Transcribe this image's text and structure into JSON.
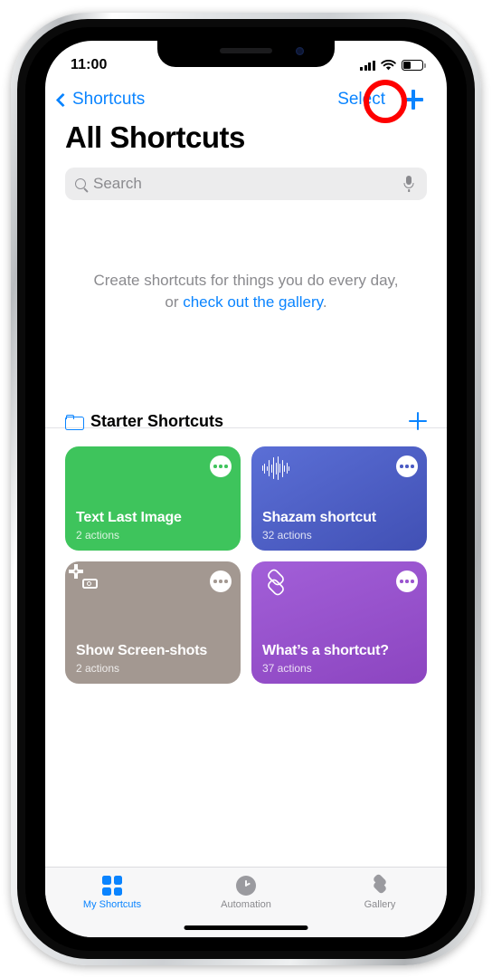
{
  "status_bar": {
    "time": "11:00",
    "signal_icon": "cellular-signal-icon",
    "wifi_icon": "wifi-icon",
    "battery_icon": "battery-icon",
    "battery_level_pct": 38
  },
  "nav": {
    "back_label": "Shortcuts",
    "back_icon": "chevron-left-icon",
    "select_label": "Select",
    "add_icon": "plus-icon"
  },
  "annotation": {
    "shape": "circle",
    "color": "#fe0000",
    "target": "add-shortcut-button"
  },
  "page": {
    "title": "All Shortcuts"
  },
  "search": {
    "placeholder": "Search",
    "icon": "magnifier-icon",
    "mic_icon": "microphone-icon"
  },
  "empty_state": {
    "line1": "Create shortcuts for things you do every day,",
    "prefix": "or ",
    "link": "check out the gallery",
    "suffix": "."
  },
  "section": {
    "title": "Starter Shortcuts",
    "folder_icon": "folder-icon",
    "add_icon": "plus-icon"
  },
  "shortcuts": [
    {
      "name": "Text Last Image",
      "actions": "2 actions",
      "color": "#3ec45c",
      "icon": "message-bubble-plus-icon",
      "menu_icon": "ellipsis-icon"
    },
    {
      "name": "Shazam shortcut",
      "actions": "32 actions",
      "color": "#4a5bc4",
      "icon": "waveform-icon",
      "menu_icon": "ellipsis-icon"
    },
    {
      "name": "Show Screen-shots",
      "actions": "2 actions",
      "color": "#a39891",
      "icon": "screenshot-scan-icon",
      "menu_icon": "ellipsis-icon"
    },
    {
      "name": "What’s a shortcut?",
      "actions": "37 actions",
      "color": "#9a54cf",
      "icon": "layers-icon",
      "menu_icon": "ellipsis-icon"
    }
  ],
  "tabs": [
    {
      "label": "My Shortcuts",
      "icon": "grid-squares-icon",
      "active": true
    },
    {
      "label": "Automation",
      "icon": "clock-icon",
      "active": false
    },
    {
      "label": "Gallery",
      "icon": "layers-stack-icon",
      "active": false
    }
  ],
  "colors": {
    "accent": "#0a84ff",
    "annotation": "#fe0000",
    "inactive": "#8a8a8e"
  }
}
